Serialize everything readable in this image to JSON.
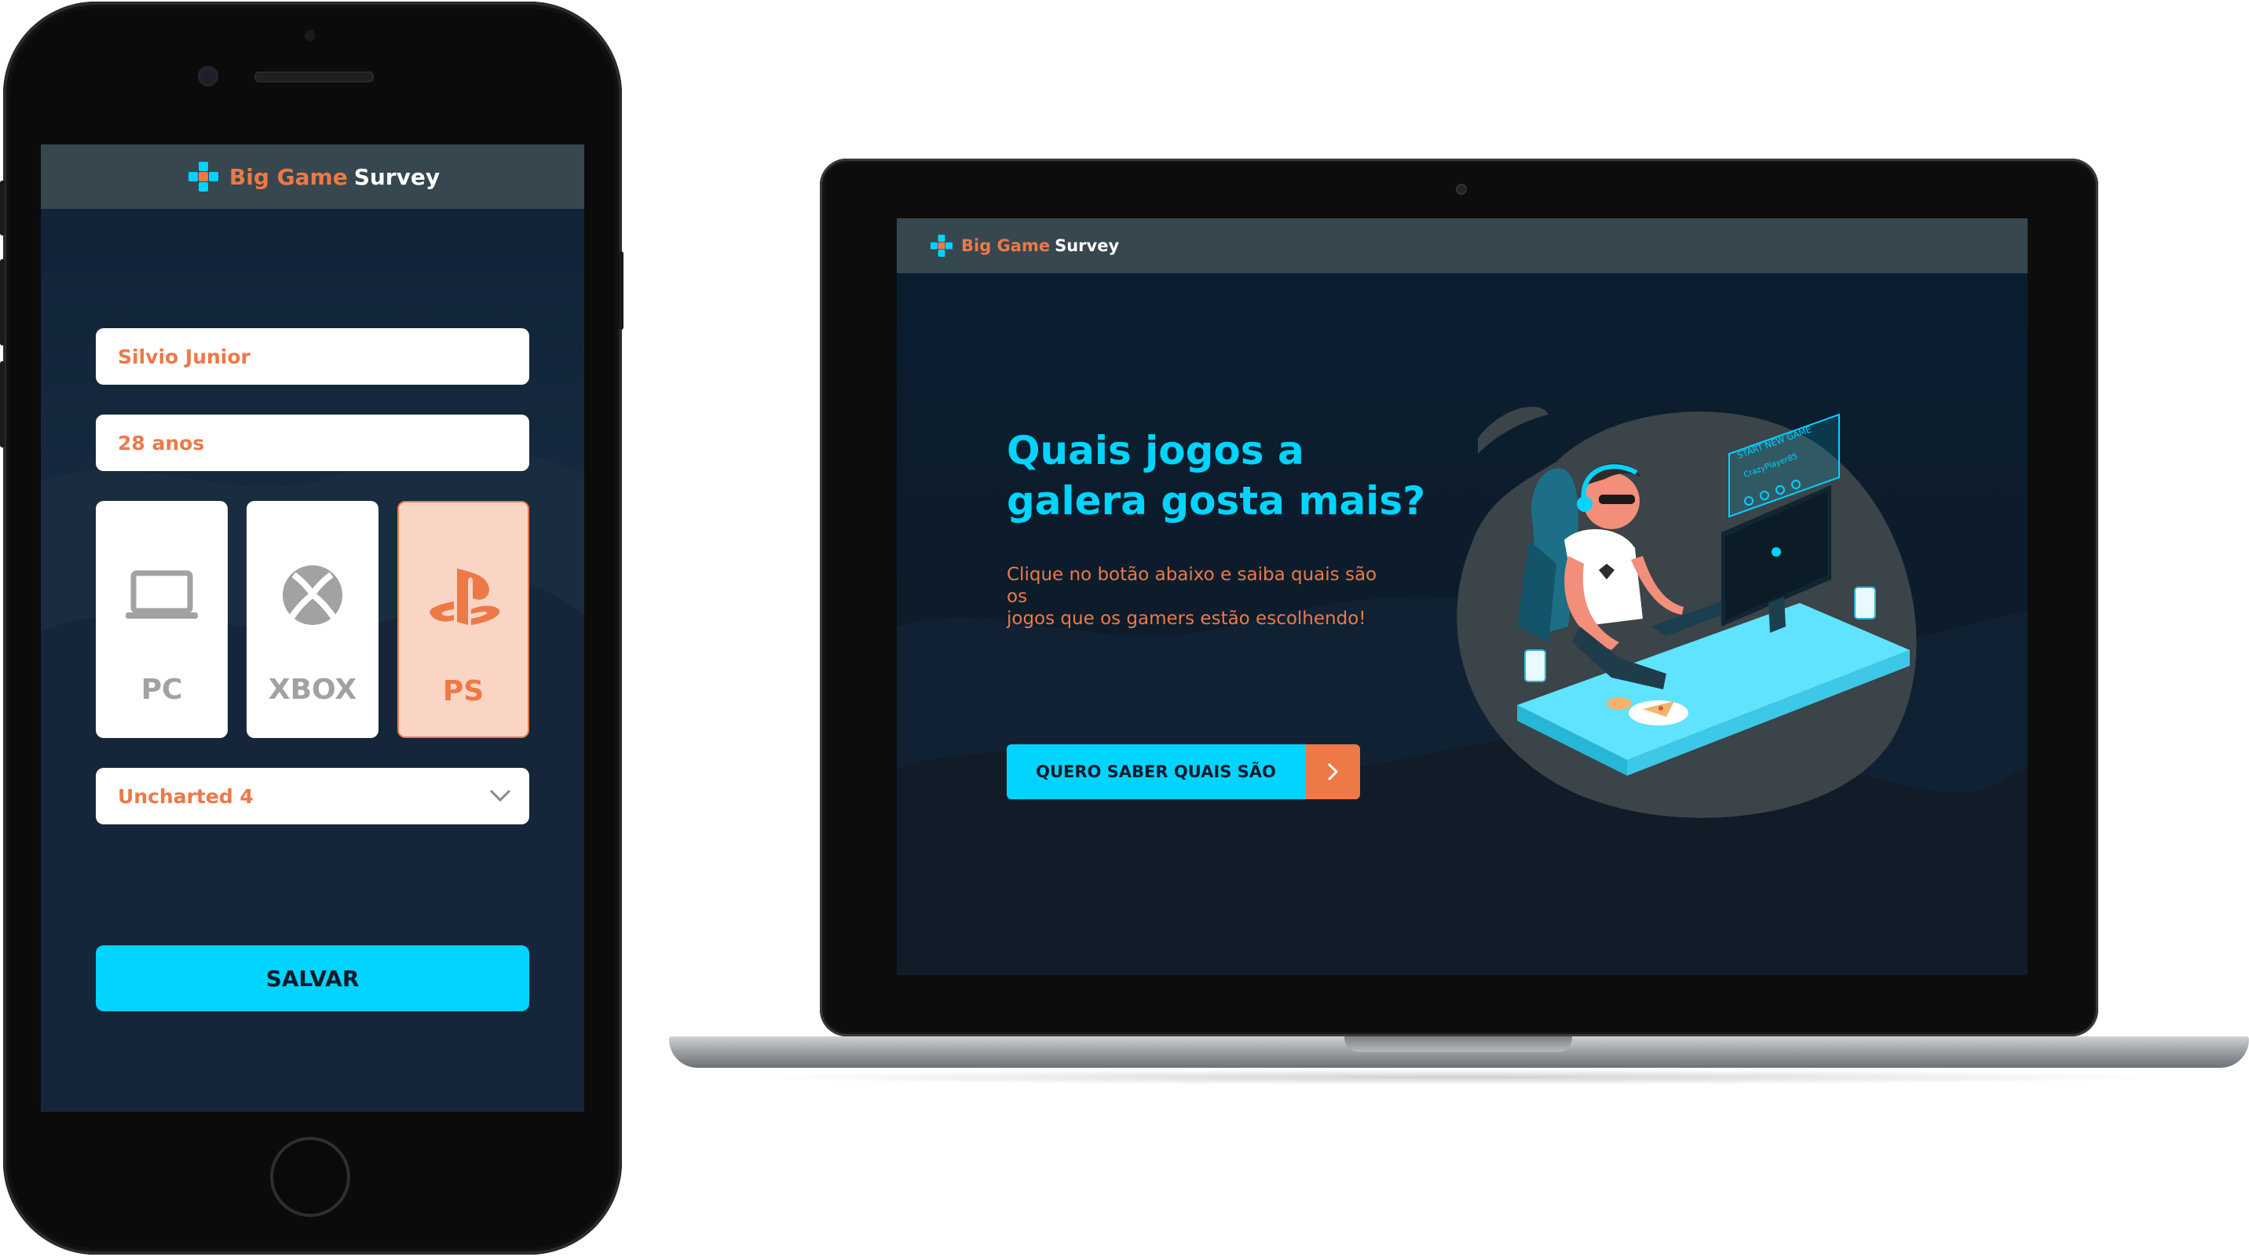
{
  "brand": {
    "word1": "Big Game",
    "word2": "Survey",
    "accent": "#ed7947",
    "primary": "#00d4ff"
  },
  "mobile": {
    "name_value": "Silvio Junior",
    "age_value": "28 anos",
    "platforms": [
      {
        "label": "PC",
        "icon": "laptop-icon",
        "selected": false
      },
      {
        "label": "XBOX",
        "icon": "xbox-icon",
        "selected": false
      },
      {
        "label": "PS",
        "icon": "playstation-icon",
        "selected": true
      }
    ],
    "game_value": "Uncharted 4",
    "save_label": "SALVAR"
  },
  "desktop": {
    "title_line1": "Quais jogos a",
    "title_line2": "galera gosta mais?",
    "subtitle_line1": "Clique no botão abaixo e saiba quais são os",
    "subtitle_line2": "jogos que os gamers estão escolhendo!",
    "cta_label": "QUERO SABER QUAIS SÃO",
    "screen_text_1": "START NEW GAME",
    "screen_text_2": "CrazyPlayer85"
  }
}
